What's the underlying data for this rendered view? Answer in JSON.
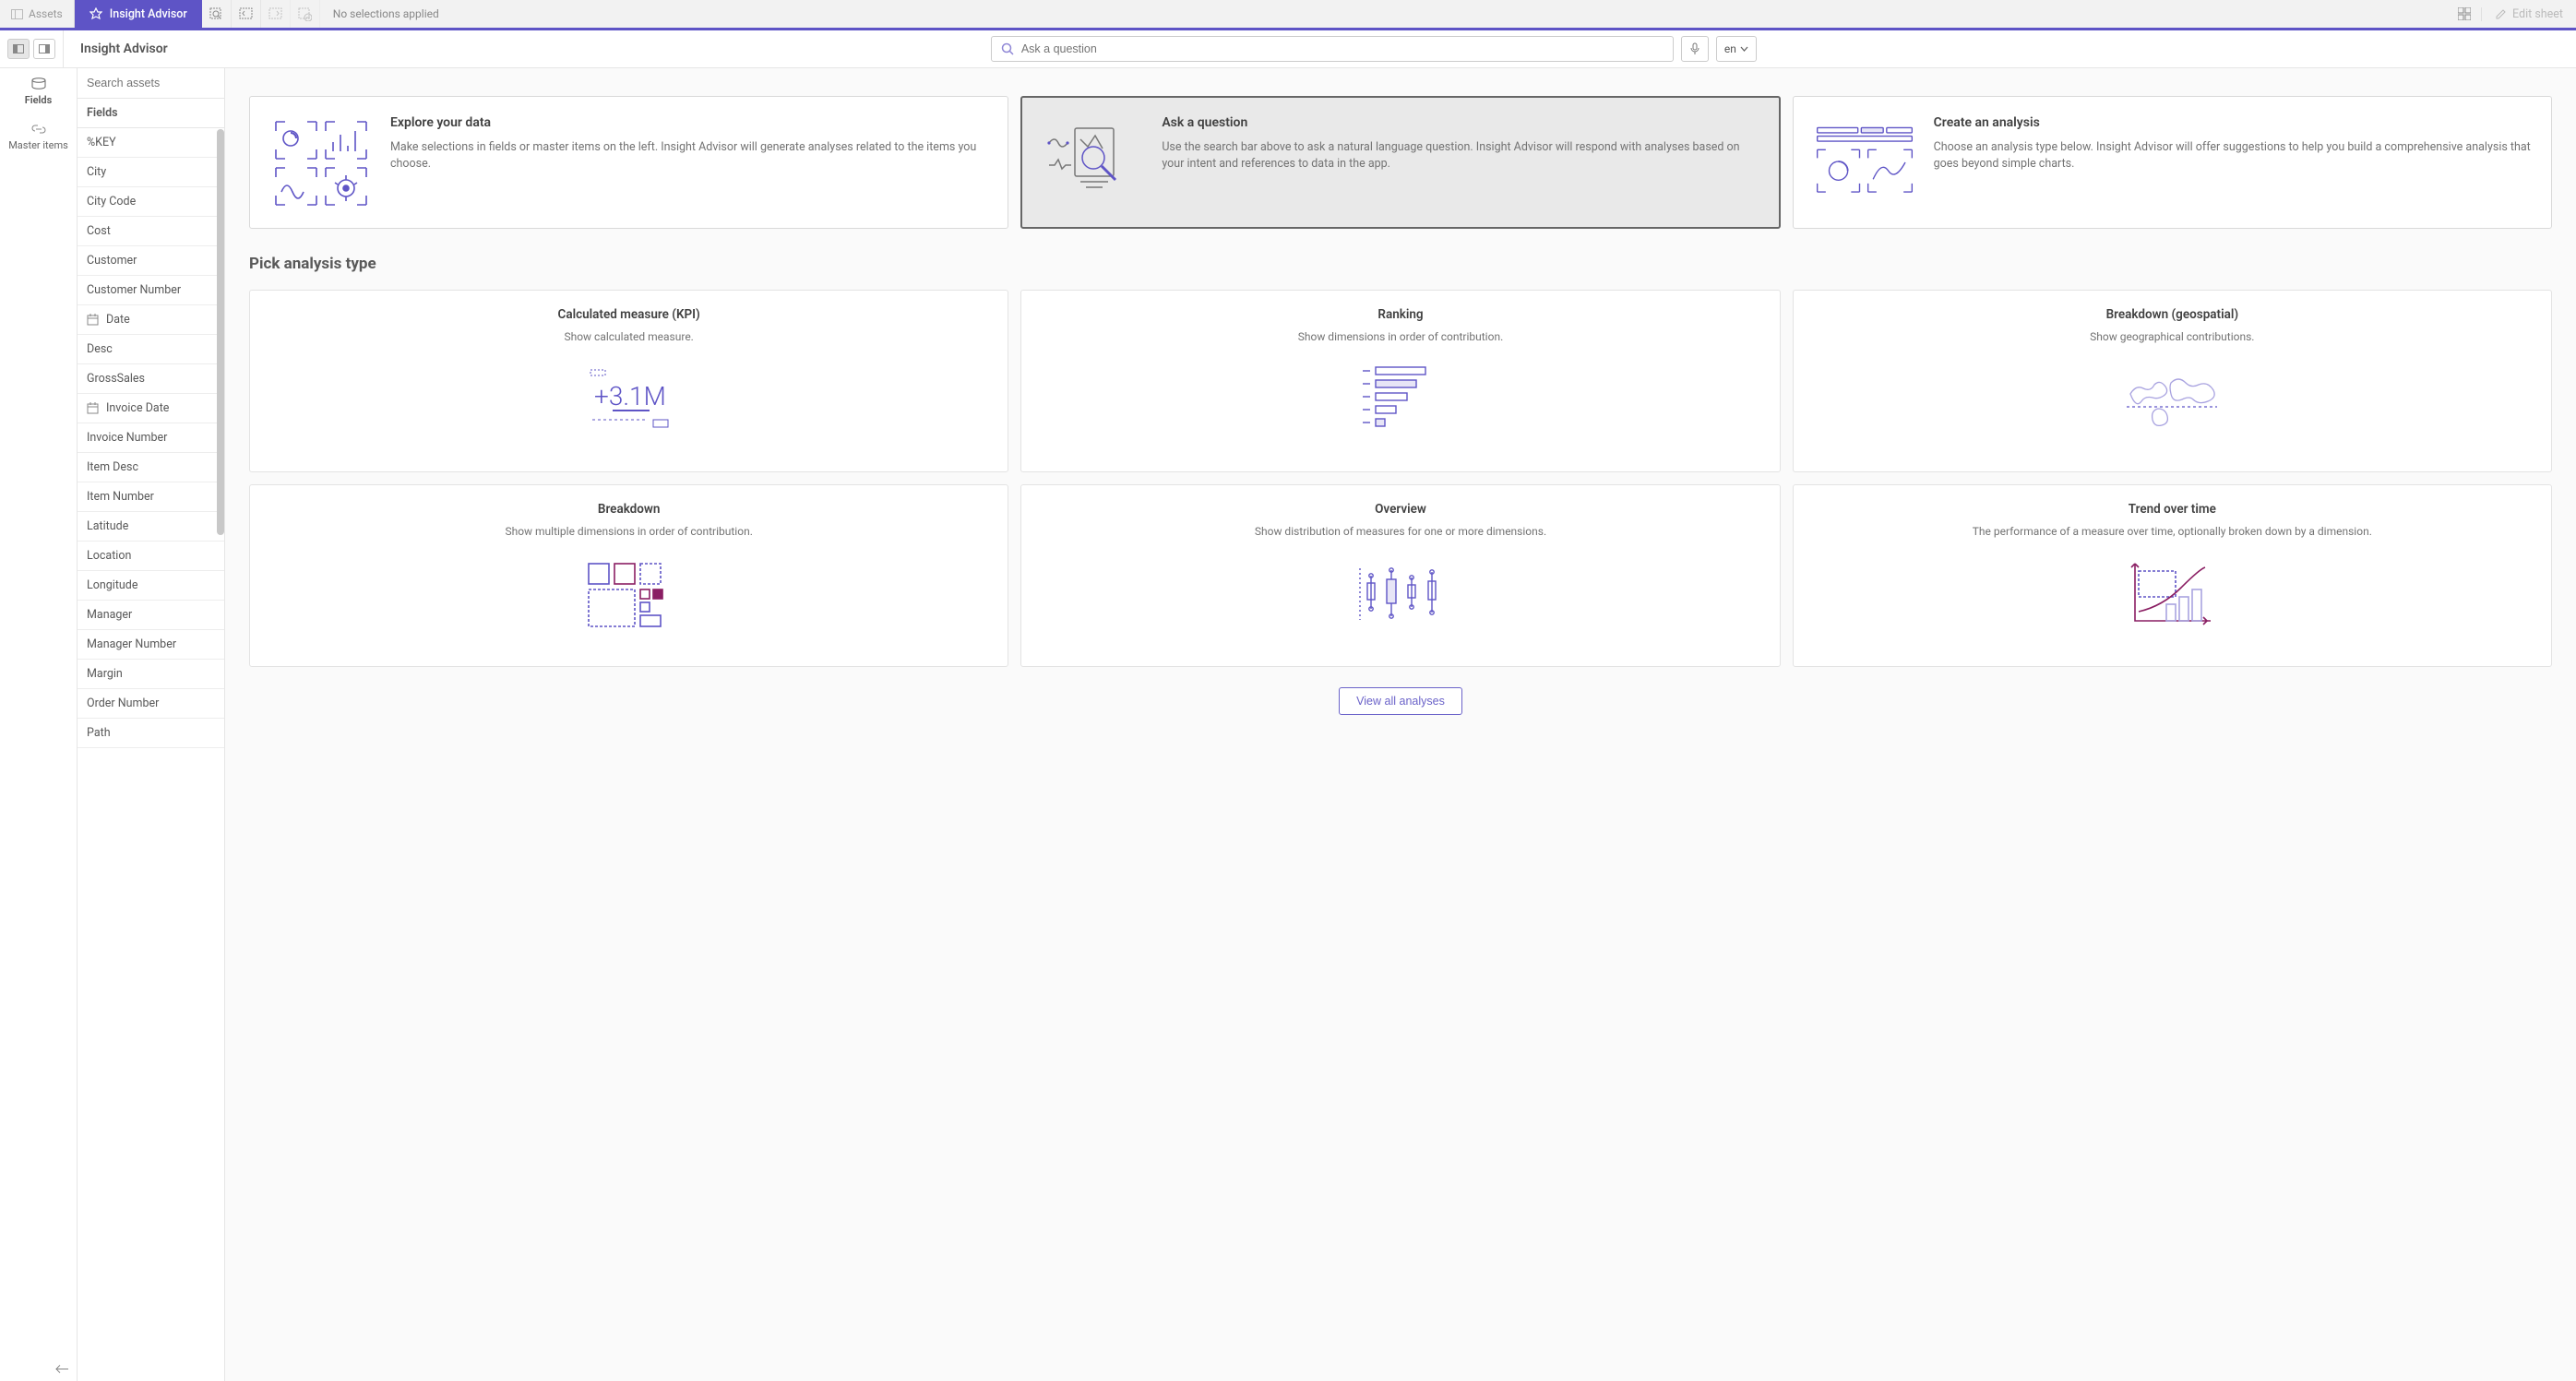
{
  "toolbar": {
    "assets_label": "Assets",
    "advisor_tab_label": "Insight Advisor",
    "no_selections": "No selections applied",
    "edit_sheet_label": "Edit sheet"
  },
  "second": {
    "title": "Insight Advisor",
    "search_placeholder": "Ask a question",
    "lang": "en"
  },
  "leftNav": {
    "fields": "Fields",
    "master_items": "Master items"
  },
  "assets": {
    "search_placeholder": "Search assets",
    "header": "Fields",
    "fields": [
      {
        "label": "%KEY",
        "icon": "none"
      },
      {
        "label": "City",
        "icon": "none"
      },
      {
        "label": "City Code",
        "icon": "none"
      },
      {
        "label": "Cost",
        "icon": "none"
      },
      {
        "label": "Customer",
        "icon": "none"
      },
      {
        "label": "Customer Number",
        "icon": "none"
      },
      {
        "label": "Date",
        "icon": "date"
      },
      {
        "label": "Desc",
        "icon": "none"
      },
      {
        "label": "GrossSales",
        "icon": "none"
      },
      {
        "label": "Invoice Date",
        "icon": "date"
      },
      {
        "label": "Invoice Number",
        "icon": "none"
      },
      {
        "label": "Item Desc",
        "icon": "none"
      },
      {
        "label": "Item Number",
        "icon": "none"
      },
      {
        "label": "Latitude",
        "icon": "none"
      },
      {
        "label": "Location",
        "icon": "none"
      },
      {
        "label": "Longitude",
        "icon": "none"
      },
      {
        "label": "Manager",
        "icon": "none"
      },
      {
        "label": "Manager Number",
        "icon": "none"
      },
      {
        "label": "Margin",
        "icon": "none"
      },
      {
        "label": "Order Number",
        "icon": "none"
      },
      {
        "label": "Path",
        "icon": "none"
      }
    ]
  },
  "heroes": [
    {
      "key": "explore",
      "title": "Explore your data",
      "desc": "Make selections in fields or master items on the left. Insight Advisor will generate analyses related to the items you choose."
    },
    {
      "key": "ask",
      "title": "Ask a question",
      "desc": "Use the search bar above to ask a natural language question. Insight Advisor will respond with analyses based on your intent and references to data in the app."
    },
    {
      "key": "create",
      "title": "Create an analysis",
      "desc": "Choose an analysis type below. Insight Advisor will offer suggestions to help you build a comprehensive analysis that goes beyond simple charts."
    }
  ],
  "section_title": "Pick analysis type",
  "analyses": [
    {
      "key": "kpi",
      "title": "Calculated measure (KPI)",
      "desc": "Show calculated measure."
    },
    {
      "key": "ranking",
      "title": "Ranking",
      "desc": "Show dimensions in order of contribution."
    },
    {
      "key": "geo",
      "title": "Breakdown (geospatial)",
      "desc": "Show geographical contributions."
    },
    {
      "key": "breakdown",
      "title": "Breakdown",
      "desc": "Show multiple dimensions in order of contribution."
    },
    {
      "key": "overview",
      "title": "Overview",
      "desc": "Show distribution of measures for one or more dimensions."
    },
    {
      "key": "trend",
      "title": "Trend over time",
      "desc": "The performance of a measure over time, optionally broken down by a dimension."
    }
  ],
  "view_all": "View all analyses",
  "colors": {
    "brand": "#5e54c6",
    "magenta": "#8a1e63",
    "navy": "#303a65"
  }
}
